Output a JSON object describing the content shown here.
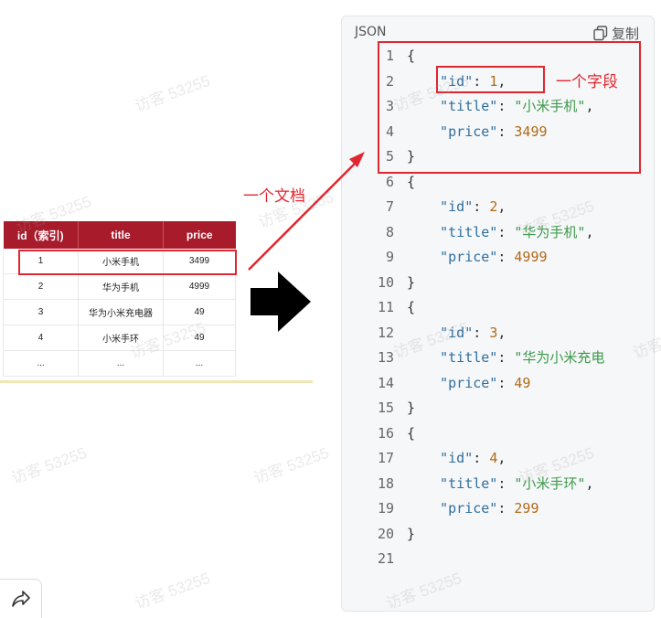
{
  "table": {
    "headers": [
      "id（索引)",
      "title",
      "price"
    ],
    "rows": [
      [
        "1",
        "小米手机",
        "3499"
      ],
      [
        "2",
        "华为手机",
        "4999"
      ],
      [
        "3",
        "华为小米充电器",
        "49"
      ],
      [
        "4",
        "小米手环",
        "49"
      ],
      [
        "...",
        "...",
        "..."
      ]
    ]
  },
  "annotations": {
    "document_label": "一个文档",
    "field_label": "一个字段"
  },
  "code_panel": {
    "language": "JSON",
    "copy_label": "复制",
    "lines": [
      [
        {
          "t": "p",
          "v": "{"
        }
      ],
      [
        {
          "t": "p",
          "v": "    "
        },
        {
          "t": "k",
          "v": "\"id\""
        },
        {
          "t": "p",
          "v": ": "
        },
        {
          "t": "n",
          "v": "1"
        },
        {
          "t": "p",
          "v": ","
        }
      ],
      [
        {
          "t": "p",
          "v": "    "
        },
        {
          "t": "k",
          "v": "\"title\""
        },
        {
          "t": "p",
          "v": ": "
        },
        {
          "t": "s",
          "v": "\"小米手机\""
        },
        {
          "t": "p",
          "v": ","
        }
      ],
      [
        {
          "t": "p",
          "v": "    "
        },
        {
          "t": "k",
          "v": "\"price\""
        },
        {
          "t": "p",
          "v": ": "
        },
        {
          "t": "n",
          "v": "3499"
        }
      ],
      [
        {
          "t": "p",
          "v": "}"
        }
      ],
      [
        {
          "t": "p",
          "v": "{"
        }
      ],
      [
        {
          "t": "p",
          "v": "    "
        },
        {
          "t": "k",
          "v": "\"id\""
        },
        {
          "t": "p",
          "v": ": "
        },
        {
          "t": "n",
          "v": "2"
        },
        {
          "t": "p",
          "v": ","
        }
      ],
      [
        {
          "t": "p",
          "v": "    "
        },
        {
          "t": "k",
          "v": "\"title\""
        },
        {
          "t": "p",
          "v": ": "
        },
        {
          "t": "s",
          "v": "\"华为手机\""
        },
        {
          "t": "p",
          "v": ","
        }
      ],
      [
        {
          "t": "p",
          "v": "    "
        },
        {
          "t": "k",
          "v": "\"price\""
        },
        {
          "t": "p",
          "v": ": "
        },
        {
          "t": "n",
          "v": "4999"
        }
      ],
      [
        {
          "t": "p",
          "v": "}"
        }
      ],
      [
        {
          "t": "p",
          "v": "{"
        }
      ],
      [
        {
          "t": "p",
          "v": "    "
        },
        {
          "t": "k",
          "v": "\"id\""
        },
        {
          "t": "p",
          "v": ": "
        },
        {
          "t": "n",
          "v": "3"
        },
        {
          "t": "p",
          "v": ","
        }
      ],
      [
        {
          "t": "p",
          "v": "    "
        },
        {
          "t": "k",
          "v": "\"title\""
        },
        {
          "t": "p",
          "v": ": "
        },
        {
          "t": "s",
          "v": "\"华为小米充电"
        }
      ],
      [
        {
          "t": "p",
          "v": "    "
        },
        {
          "t": "k",
          "v": "\"price\""
        },
        {
          "t": "p",
          "v": ": "
        },
        {
          "t": "n",
          "v": "49"
        }
      ],
      [
        {
          "t": "p",
          "v": "}"
        }
      ],
      [
        {
          "t": "p",
          "v": "{"
        }
      ],
      [
        {
          "t": "p",
          "v": "    "
        },
        {
          "t": "k",
          "v": "\"id\""
        },
        {
          "t": "p",
          "v": ": "
        },
        {
          "t": "n",
          "v": "4"
        },
        {
          "t": "p",
          "v": ","
        }
      ],
      [
        {
          "t": "p",
          "v": "    "
        },
        {
          "t": "k",
          "v": "\"title\""
        },
        {
          "t": "p",
          "v": ": "
        },
        {
          "t": "s",
          "v": "\"小米手环\""
        },
        {
          "t": "p",
          "v": ","
        }
      ],
      [
        {
          "t": "p",
          "v": "    "
        },
        {
          "t": "k",
          "v": "\"price\""
        },
        {
          "t": "p",
          "v": ": "
        },
        {
          "t": "n",
          "v": "299"
        }
      ],
      [
        {
          "t": "p",
          "v": "}"
        }
      ],
      []
    ]
  },
  "watermark": "访客 53255",
  "colors": {
    "header_bg": "#a71b2b",
    "annotation": "#e0262f",
    "key": "#2f6f9f",
    "string": "#3c9a4a",
    "number": "#b06a18"
  }
}
